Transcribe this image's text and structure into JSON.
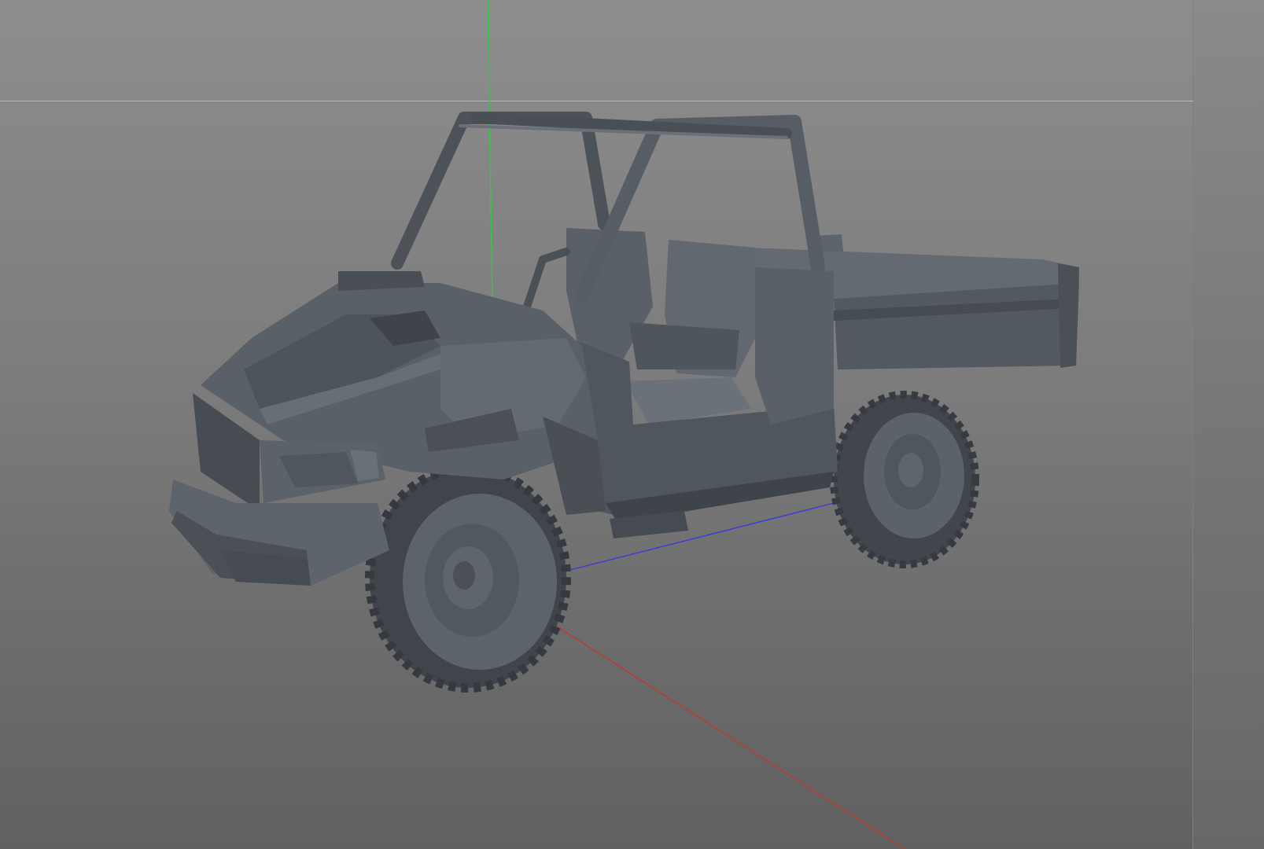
{
  "viewport": {
    "background_top": "#8d8d8d",
    "background_bottom": "#616161",
    "horizon_color": "#b6b6b6"
  },
  "axes": {
    "x_axis_color": "#c0392b",
    "y_axis_color": "#2ecc40",
    "z_axis_color": "#3a3ad8"
  },
  "model": {
    "body_color": "#5b6169",
    "body_light": "#6e747c",
    "body_dark": "#454a51",
    "tire_color": "#4a4f56",
    "icon": "utv-vehicle-model"
  }
}
